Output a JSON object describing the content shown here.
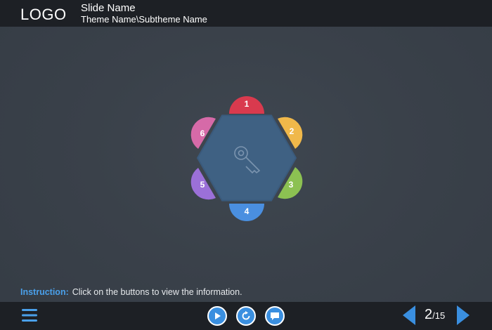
{
  "header": {
    "logo": "LOGO",
    "slide_name": "Slide Name",
    "theme_path": "Theme Name\\Subtheme Name"
  },
  "diagram": {
    "center_icon": "key-icon",
    "petals": [
      {
        "label": "1",
        "color": "#d93a4e"
      },
      {
        "label": "2",
        "color": "#f0b84a"
      },
      {
        "label": "3",
        "color": "#8cc152"
      },
      {
        "label": "4",
        "color": "#4a8fe0"
      },
      {
        "label": "5",
        "color": "#9b70d8"
      },
      {
        "label": "6",
        "color": "#d66aa8"
      }
    ],
    "hexagon_color": "#3f6488"
  },
  "instruction": {
    "label": "Instruction:",
    "text": "Click on the buttons to view the information."
  },
  "footer": {
    "menu_icon": "menu-icon",
    "play_icon": "play-icon",
    "replay_icon": "replay-icon",
    "comment_icon": "comment-icon",
    "current_page": "2",
    "total_pages": "/15",
    "prev_icon": "arrow-left-icon",
    "next_icon": "arrow-right-icon",
    "accent_color": "#3a8fe0"
  }
}
